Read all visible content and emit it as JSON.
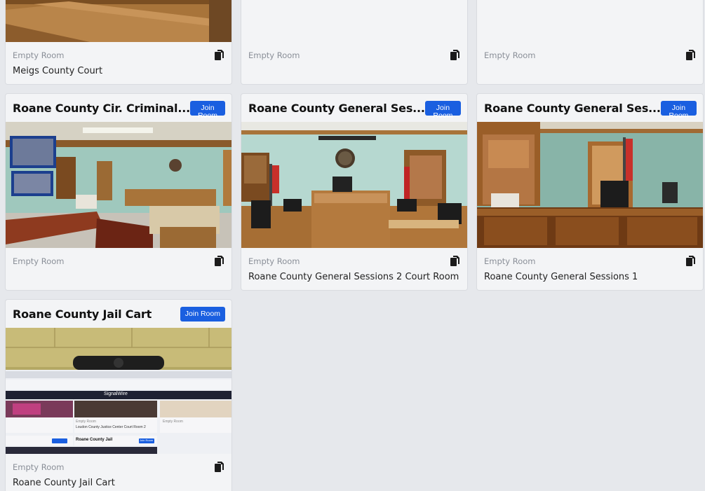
{
  "rooms": [
    {
      "title": "",
      "status": "Empty Room",
      "name": "Meigs County Court"
    },
    {
      "title": "",
      "status": "Empty Room",
      "name": ""
    },
    {
      "title": "",
      "status": "Empty Room",
      "name": ""
    },
    {
      "title": "Roane County Cir. Criminal...",
      "join_label": "Join Room",
      "status": "Empty Room",
      "name": ""
    },
    {
      "title": "Roane County General Ses...",
      "join_label": "Join Room",
      "status": "Empty Room",
      "name": "Roane County General Sessions 2 Court Room"
    },
    {
      "title": "Roane County General Ses...",
      "join_label": "Join Room",
      "status": "Empty Room",
      "name": "Roane County General Sessions 1"
    },
    {
      "title": "Roane County Jail Cart",
      "join_label": "Join Room",
      "status": "Empty Room",
      "name": "Roane County Jail Cart"
    }
  ],
  "jail_cart_screen": {
    "brand": "SignalWire",
    "tiles": [
      {
        "status": "Empty Room",
        "name": "Loudon County Justice Center Court Room 2"
      },
      {
        "status": "Empty Room",
        "name": ""
      }
    ],
    "cards": [
      {
        "title": "Roane County Jail",
        "join_label": "Join Room"
      }
    ]
  },
  "colors": {
    "accent": "#1a5fe0",
    "background": "#e6e8ec",
    "card": "#f3f4f6"
  },
  "icons": {
    "copy": "copy-icon"
  }
}
